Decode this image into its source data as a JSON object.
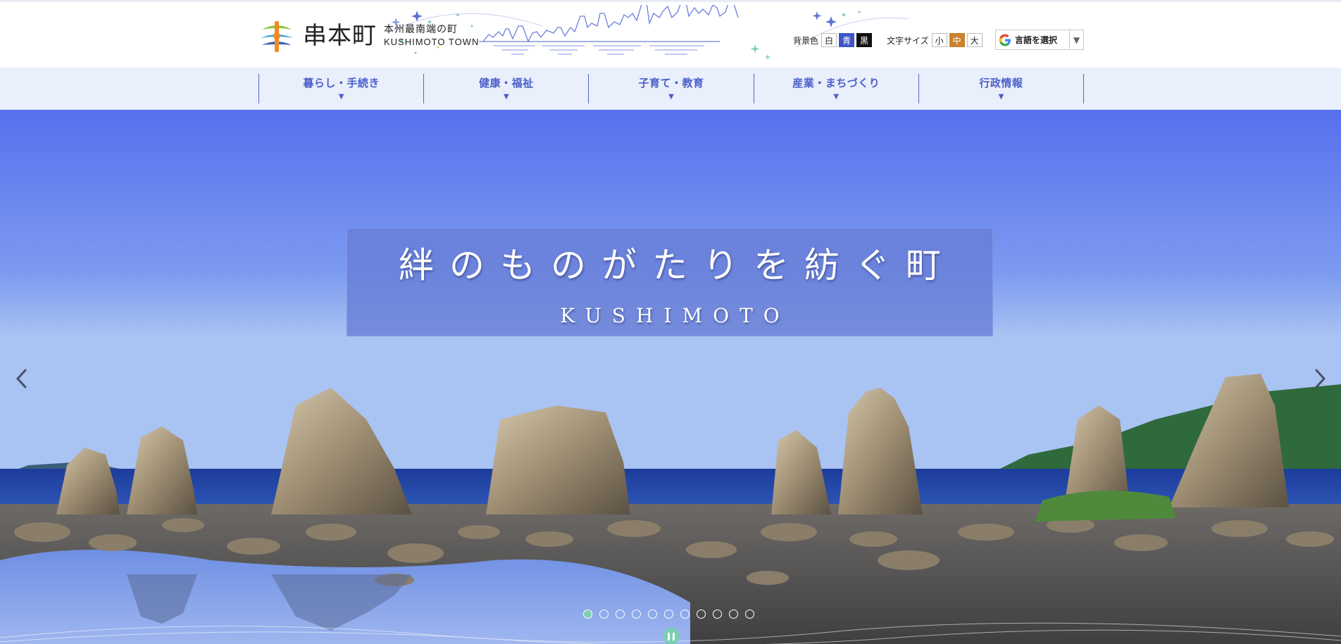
{
  "header": {
    "logo_name": "串本町",
    "logo_sub_ja": "本州最南端の町",
    "logo_sub_en": "KUSHIMOTO TOWN",
    "bg_color_label": "背景色",
    "bg_color_options": [
      "白",
      "青",
      "黒"
    ],
    "font_size_label": "文字サイズ",
    "font_size_options": [
      "小",
      "中",
      "大"
    ],
    "language_label": "言語を選択",
    "language_caret": "▼"
  },
  "nav": {
    "items": [
      {
        "label": "暮らし・手続き"
      },
      {
        "label": "健康・福祉"
      },
      {
        "label": "子育て・教育"
      },
      {
        "label": "産業・まちづくり"
      },
      {
        "label": "行政情報"
      }
    ],
    "caret": "▼"
  },
  "hero": {
    "title": "絆のものがたりを紡ぐ町",
    "subtitle": "KUSHIMOTO",
    "slide_count": 11,
    "active_slide": 1
  },
  "icons": {
    "prev": "chevron-left-icon",
    "next": "chevron-right-icon",
    "pause": "pause-icon",
    "google": "google-logo-icon"
  },
  "colors": {
    "nav_text": "#4b5fc9",
    "nav_bg": "#e9effb",
    "accent_teal": "#7ccfb4",
    "blue_btn": "#3f54c5",
    "orange_btn": "#c8832b"
  }
}
